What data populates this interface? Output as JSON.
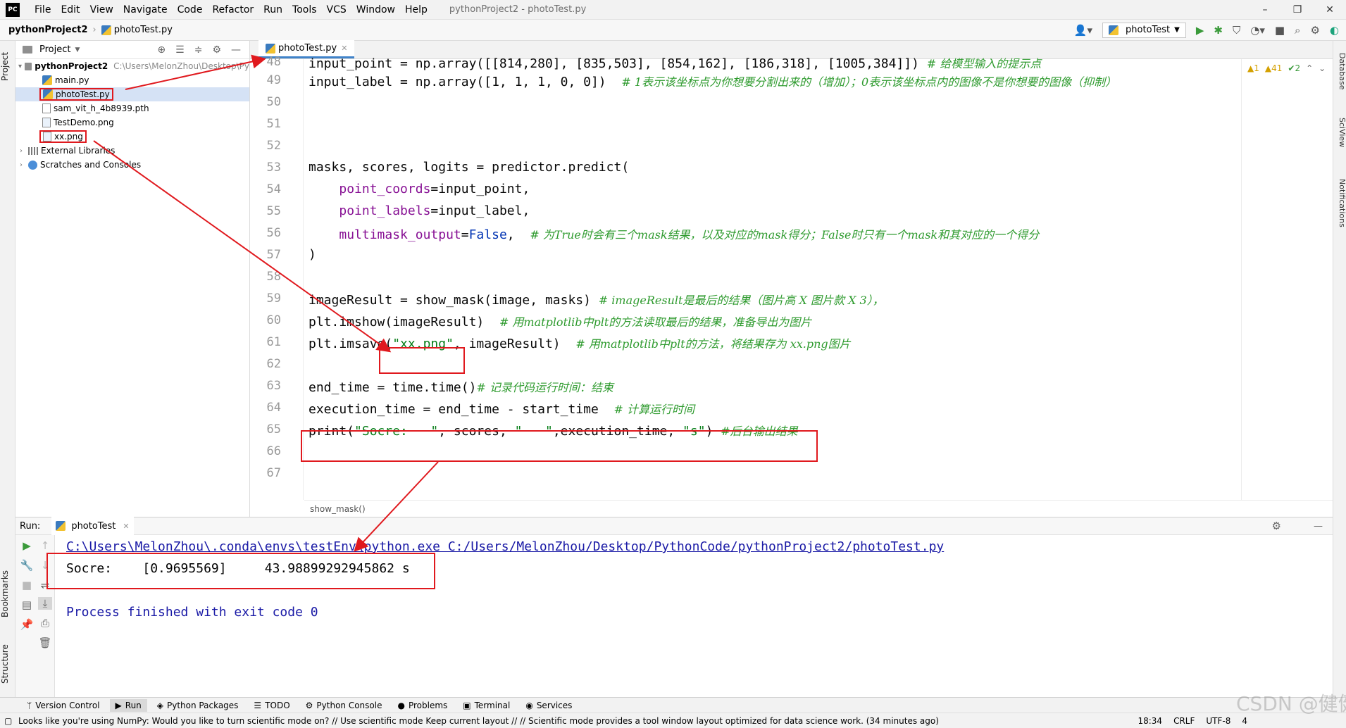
{
  "menubar": {
    "logo": "PC",
    "items": [
      "File",
      "Edit",
      "View",
      "Navigate",
      "Code",
      "Refactor",
      "Run",
      "Tools",
      "VCS",
      "Window",
      "Help"
    ],
    "window_title": "pythonProject2 - photoTest.py",
    "controls": [
      "–",
      "❐",
      "✕"
    ]
  },
  "navbar": {
    "project": "pythonProject2",
    "file": "photoTest.py",
    "run_config": "photoTest"
  },
  "left_strip": {
    "project_tab": "Project",
    "bookmarks_tab": "Bookmarks",
    "structure_tab": "Structure"
  },
  "right_strip": {
    "database_tab": "Database",
    "sciview_tab": "SciView",
    "notifications_tab": "Notifications"
  },
  "project_panel": {
    "title": "Project",
    "root": {
      "name": "pythonProject2",
      "path": "C:\\Users\\MelonZhou\\Desktop\\Py"
    },
    "files": [
      "main.py",
      "photoTest.py",
      "sam_vit_h_4b8939.pth",
      "TestDemo.png",
      "xx.png"
    ],
    "external": "External Libraries",
    "scratches": "Scratches and Consoles"
  },
  "editor": {
    "tab": "photoTest.py",
    "line_numbers": [
      "48",
      "49",
      "50",
      "51",
      "52",
      "53",
      "54",
      "55",
      "56",
      "57",
      "58",
      "59",
      "60",
      "61",
      "62",
      "63",
      "64",
      "65",
      "66",
      "67"
    ],
    "lines": {
      "l48_code": "input_point = np.array([[814,280], [835,503], [854,162], [186,318], [1005,384]])",
      "l48_comment": "# 给模型输入的提示点",
      "l49_code": "input_label = np.array([1, 1, 1, 0, 0])",
      "l49_comment": "# 1表示该坐标点为你想要分割出来的（增加）；0表示该坐标点内的图像不是你想要的图像（抑制）",
      "l53_code": "masks, scores, logits = predictor.predict(",
      "l54_param": "point_coords",
      "l54_rest": "=input_point,",
      "l55_param": "point_labels",
      "l55_rest": "=input_label,",
      "l56_param": "multimask_output",
      "l56_eq": "=",
      "l56_kw": "False",
      "l56_rest": ",",
      "l56_comment": "# 为True时会有三个mask结果，以及对应的mask得分；False时只有一个mask和其对应的一个得分",
      "l57_code": ")",
      "l59_code": "imageResult = show_mask(image, masks)",
      "l59_comment": "# imageResult是最后的结果（图片高 X 图片款 X 3），",
      "l60_code": "plt.imshow(imageResult)",
      "l60_comment": "# 用matplotlib中plt的方法读取最后的结果，准备导出为图片",
      "l61_pre": "plt.imsave(",
      "l61_str": "\"xx.png\"",
      "l61_rest": ", imageResult)",
      "l61_comment": "# 用matplotlib中plt的方法，将结果存为 xx.png图片",
      "l63_code": "end_time = time.time()",
      "l63_comment": "# 记录代码运行时间：结束",
      "l64_code": "execution_time = end_time - start_time",
      "l64_comment": "# 计算运行时间",
      "l65_pre": "print(",
      "l65_str1": "\"Socre:   \"",
      "l65_mid": ", scores, ",
      "l65_str2": "\"   \"",
      "l65_mid2": ",execution_time, ",
      "l65_str3": "\"s\"",
      "l65_close": ")",
      "l65_comment": "#后台输出结果"
    },
    "inspections": {
      "errors": "1",
      "warnings": "41",
      "weak": "2"
    },
    "footer_breadcrumb": "show_mask()"
  },
  "run_panel": {
    "label": "Run:",
    "tab": "photoTest",
    "command": "C:\\Users\\MelonZhou\\.conda\\envs\\testEnv\\python.exe C:/Users/MelonZhou/Desktop/PythonCode/pythonProject2/photoTest.py",
    "output": "Socre:    [0.9695569]     43.98899292945862 s",
    "exit": "Process finished with exit code 0"
  },
  "toolwindows": [
    "Version Control",
    "Run",
    "Python Packages",
    "TODO",
    "Python Console",
    "Problems",
    "Terminal",
    "Services"
  ],
  "statusbar": {
    "message": "Looks like you're using NumPy: Would you like to turn scientific mode on? // Use scientific mode   Keep current layout // // Scientific mode provides a tool window layout optimized for data science work. (34 minutes ago)",
    "position": "18:34",
    "line_sep": "CRLF",
    "encoding": "UTF-8",
    "indent": "4"
  },
  "watermark": "CSDN @健健zhou",
  "colors": {
    "annotation": "#e0191e",
    "accent": "#4083c9"
  }
}
